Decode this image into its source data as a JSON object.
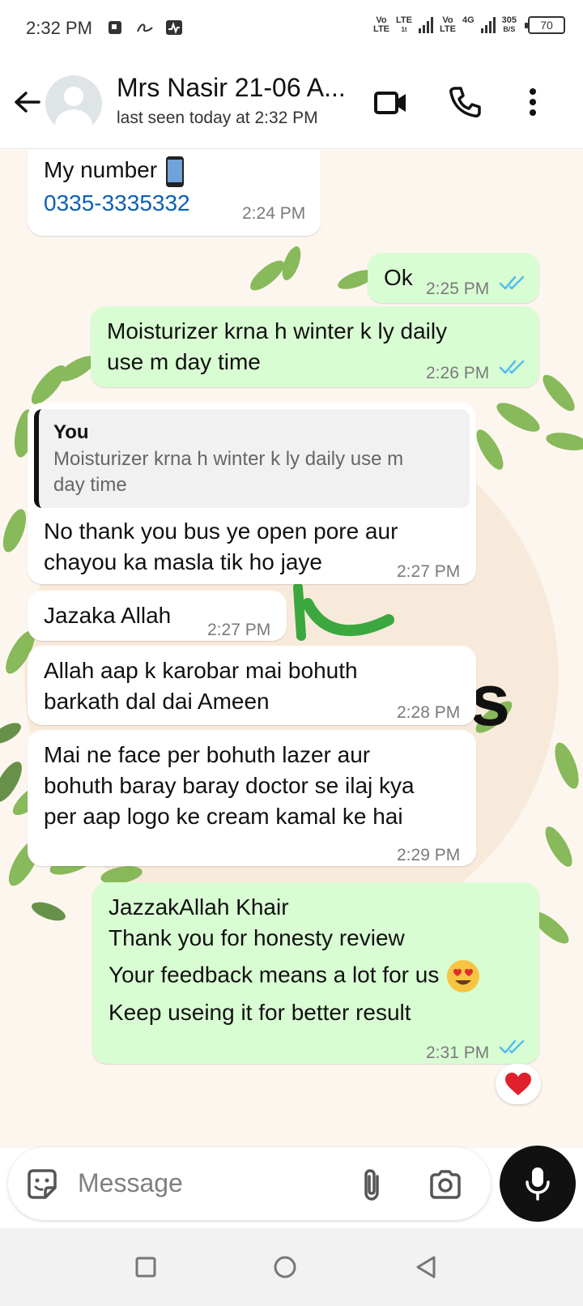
{
  "status_bar": {
    "time": "2:32 PM",
    "left_icons": [
      "calendar-icon",
      "scribble-icon",
      "activity-icon"
    ],
    "net1_top": "Vo",
    "net1_bottom": "LTE",
    "net2_top": "LTE",
    "net2_bottom": "1t",
    "net3_top": "Vo",
    "net3_bottom": "LTE",
    "net4": "4G",
    "speed_top": "305",
    "speed_bottom": "B/S",
    "battery": "70"
  },
  "header": {
    "contact_name": "Mrs Nasir 21-06 A...",
    "last_seen": "last seen today at 2:32 PM",
    "icons": [
      "back-arrow-icon",
      "video-call-icon",
      "phone-icon",
      "more-vertical-icon"
    ]
  },
  "messages": [
    {
      "dir": "in",
      "text": "My number",
      "link": "0335-3335332",
      "time": "2:24 PM",
      "emoji": "mobile-phone-emoji"
    },
    {
      "dir": "out",
      "text": "Ok",
      "time": "2:25 PM",
      "status": "read"
    },
    {
      "dir": "out",
      "text": "Moisturizer krna h winter k ly daily\nuse m day time",
      "time": "2:26 PM",
      "status": "read"
    },
    {
      "dir": "in",
      "quote_author": "You",
      "quote_text": "Moisturizer krna h winter k ly daily use m\nday time",
      "text": "No thank you bus ye open pore aur\nchayou ka masla tik ho jaye",
      "time": "2:27 PM"
    },
    {
      "dir": "in",
      "text": "Jazaka Allah",
      "time": "2:27 PM"
    },
    {
      "dir": "in",
      "text": "Allah aap k karobar mai bohuth\nbarkath dal dai Ameen",
      "time": "2:28 PM"
    },
    {
      "dir": "in",
      "text": "Mai ne face per bohuth lazer aur\nbohuth baray baray doctor se ilaj kya\nper aap logo ke cream kamal ke hai",
      "time": "2:29 PM"
    },
    {
      "dir": "out",
      "lines": [
        "JazzakAllah Khair",
        "Thank you for honesty review",
        "Your feedback means a lot for us",
        "Keep useing it for better result"
      ],
      "time": "2:31 PM",
      "status": "read",
      "emoji": "heart-eyes-emoji",
      "reaction": "red-heart-emoji"
    }
  ],
  "wallpaper_text": "s",
  "input": {
    "placeholder": "Message",
    "value": "",
    "icons": [
      "sticker-icon",
      "paperclip-icon",
      "camera-icon",
      "mic-icon"
    ]
  },
  "nav": {
    "icons": [
      "recents-square-icon",
      "home-circle-icon",
      "back-triangle-icon"
    ]
  },
  "colors": {
    "outgoing_bubble": "#d9fdd3",
    "incoming_bubble": "#ffffff",
    "read_ticks": "#53bdeb",
    "link": "#0b5fb8",
    "wallpaper": "#fdf6ef"
  }
}
